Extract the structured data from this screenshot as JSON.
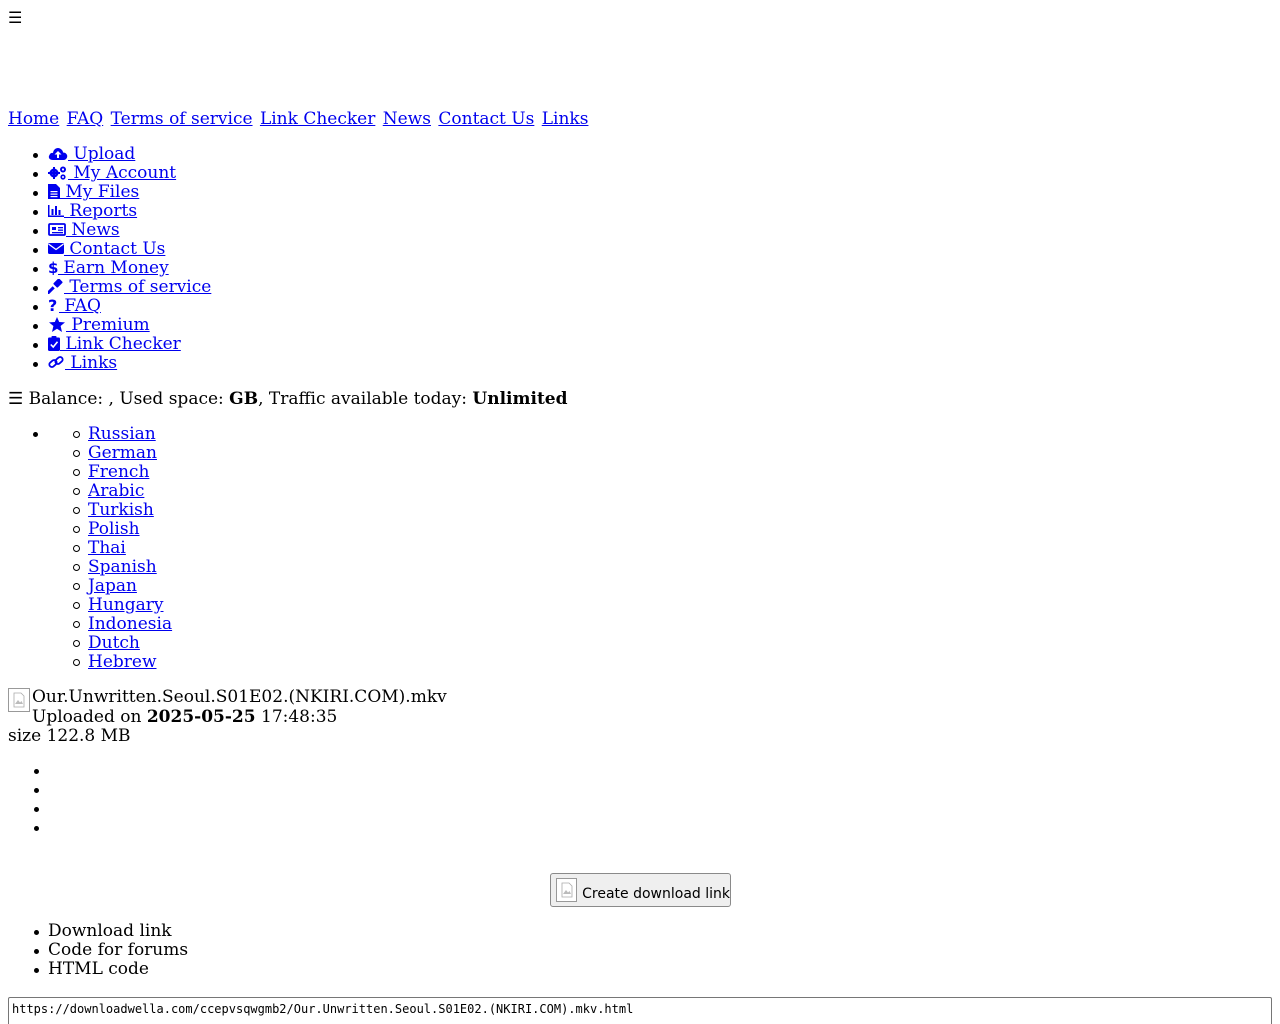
{
  "menu_toggle": "☰",
  "top_nav": [
    "Home",
    "FAQ",
    "Terms of service",
    "Link Checker",
    "News",
    "Contact Us",
    "Links"
  ],
  "side_menu": [
    {
      "label": " Upload",
      "icon": "cloud-upload-icon"
    },
    {
      "label": " My Account",
      "icon": "gears-icon"
    },
    {
      "label": " My Files",
      "icon": "file-icon"
    },
    {
      "label": " Reports",
      "icon": "bar-chart-icon"
    },
    {
      "label": " News",
      "icon": "newspaper-icon"
    },
    {
      "label": " Contact Us",
      "icon": "envelope-icon"
    },
    {
      "label": " Earn Money",
      "icon": "dollar-icon"
    },
    {
      "label": " Terms of service",
      "icon": "gavel-icon"
    },
    {
      "label": " FAQ",
      "icon": "question-icon"
    },
    {
      "label": " Premium",
      "icon": "star-icon"
    },
    {
      "label": " Link Checker",
      "icon": "clipboard-check-icon"
    },
    {
      "label": " Links",
      "icon": "link-icon"
    }
  ],
  "balance_bar": {
    "prefix": "☰ Balance: , Used space: ",
    "used_unit": "GB",
    "traffic_label": ", Traffic available today: ",
    "traffic_value": "Unlimited"
  },
  "languages": [
    "Russian",
    "German",
    "French",
    "Arabic",
    "Turkish",
    "Polish",
    "Thai",
    "Spanish",
    "Japan",
    "Hungary",
    "Indonesia",
    "Dutch",
    "Hebrew"
  ],
  "file": {
    "name": "Our.Unwritten.Seoul.S01E02.(NKIRI.COM).mkv",
    "uploaded_prefix": "Uploaded on ",
    "uploaded_date": "2025-05-25",
    "uploaded_time": " 17:48:35",
    "size_label": "size 122.8 MB"
  },
  "create_button_label": "Create download link",
  "code_tabs": [
    "Download link",
    "Code for forums",
    "HTML code"
  ],
  "download_url": "https://downloadwella.com/ccepvsqwgmb2/Our.Unwritten.Seoul.S01E02.(NKIRI.COM).mkv.html",
  "colors": {
    "link": "#0000ee",
    "icon": "#0000ee"
  }
}
